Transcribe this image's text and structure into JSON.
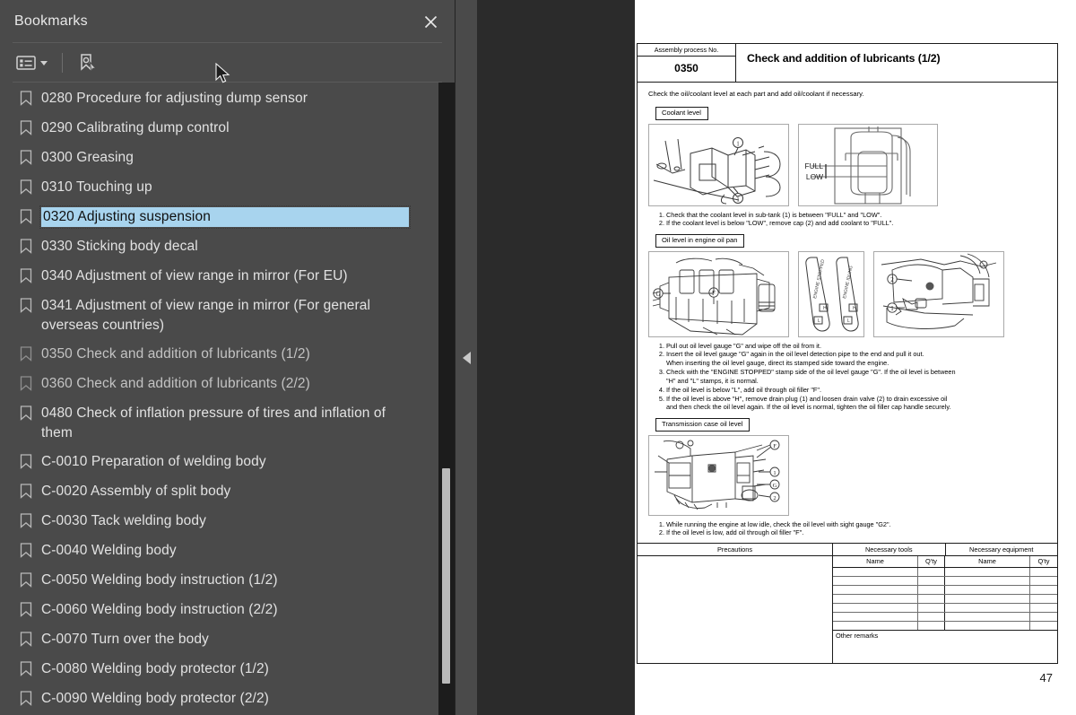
{
  "panel": {
    "title": "Bookmarks",
    "close_icon": "close-icon",
    "toolbar": {
      "options_icon": "list-options-icon",
      "caret_icon": "chevron-down-icon",
      "find_bookmark_icon": "find-current-bookmark-icon"
    },
    "bookmarks": [
      {
        "label": "0280 Procedure for adjusting dump sensor",
        "state": "normal"
      },
      {
        "label": "0290 Calibrating dump control",
        "state": "normal"
      },
      {
        "label": "0300 Greasing",
        "state": "normal"
      },
      {
        "label": "0310 Touching up",
        "state": "normal"
      },
      {
        "label": "0320 Adjusting suspension",
        "state": "selected"
      },
      {
        "label": "0330 Sticking body decal",
        "state": "normal"
      },
      {
        "label": "0340 Adjustment of view range in mirror (For EU)",
        "state": "normal"
      },
      {
        "label": "0341 Adjustment of view range in mirror (For general overseas countries)",
        "state": "normal"
      },
      {
        "label": "0350 Check and addition of lubricants (1/2)",
        "state": "dim"
      },
      {
        "label": "0360 Check and addition of lubricants (2/2)",
        "state": "dim"
      },
      {
        "label": "0480 Check of inflation pressure of tires and inflation of them",
        "state": "normal"
      },
      {
        "label": "C-0010 Preparation of welding body",
        "state": "normal"
      },
      {
        "label": "C-0020 Assembly of split body",
        "state": "normal"
      },
      {
        "label": "C-0030 Tack welding body",
        "state": "normal"
      },
      {
        "label": "C-0040 Welding body",
        "state": "normal"
      },
      {
        "label": "C-0050 Welding body instruction (1/2)",
        "state": "normal"
      },
      {
        "label": "C-0060 Welding body instruction (2/2)",
        "state": "normal"
      },
      {
        "label": "C-0070 Turn over the body",
        "state": "normal"
      },
      {
        "label": "C-0080 Welding body protector (1/2)",
        "state": "normal"
      },
      {
        "label": "C-0090 Welding body protector (2/2)",
        "state": "normal"
      }
    ]
  },
  "splitter": {
    "collapse_icon": "collapse-left-arrow-icon"
  },
  "document": {
    "header": {
      "process_label": "Assembly process No.",
      "process_number": "0350",
      "title": "Check and addition of lubricants (1/2)"
    },
    "lead": "Check the oil/coolant level at each part and add oil/coolant if necessary.",
    "sections": [
      {
        "tag": "Coolant level",
        "steps": [
          {
            "num": "1.",
            "text": "Check that the coolant level in sub-tank (1) is between \"FULL\" and \"LOW\"."
          },
          {
            "num": "2.",
            "text": "If the coolant level is below \"LOW\", remove cap (2) and add coolant to \"FULL\"."
          }
        ],
        "figure_labels": {
          "full": "FULL",
          "low": "LOW",
          "callout_1": "1",
          "callout_2": "2"
        }
      },
      {
        "tag": "Oil level in engine oil pan",
        "steps": [
          {
            "num": "1.",
            "text": "Pull out oil level gauge \"G\" and wipe off the oil from it."
          },
          {
            "num": "2.",
            "text": "Insert the oil level gauge \"G\" again in the oil level detection pipe to the end and pull it out.",
            "cont": "When inserting the oil level gauge, direct its stamped side toward the engine."
          },
          {
            "num": "3.",
            "text": "Check with the \"ENGINE STOPPED\" stamp side of the oil level gauge \"G\".  If the oil level is between",
            "cont": "\"H\" and \"L\" stamps, it is normal."
          },
          {
            "num": "4.",
            "text": "If the oil level is below \"L\", add oil through oil filler \"F\"."
          },
          {
            "num": "5.",
            "text": "If the oil level is above \"H\", remove drain plug (1) and loosen drain valve (2) to drain excessive oil",
            "cont": "and then check the oil level again.  If the oil level is normal, tighten the oil filler cap handle securely."
          }
        ],
        "figure_labels": {
          "gauge_g": "G",
          "filler_f": "F",
          "callout_1": "1",
          "callout_2": "2"
        }
      },
      {
        "tag": "Transmission case oil level",
        "steps": [
          {
            "num": "1.",
            "text": "While running the engine at low idle, check the oil level with sight gauge \"G2\"."
          },
          {
            "num": "2.",
            "text": "If the oil level is low, add oil through oil filler \"F\"."
          }
        ],
        "figure_labels": {
          "filler_f": "F",
          "gauge_g": "G",
          "callout_1": "1",
          "callout_2": "2"
        }
      }
    ],
    "table": {
      "precautions_header": "Precautions",
      "tools_header": "Necessary tools",
      "equipment_header": "Necessary equipment",
      "name_header": "Name",
      "qty_header": "Q'ty",
      "other_remarks": "Other remarks",
      "empty_rows": 7
    },
    "page_number": "47"
  }
}
